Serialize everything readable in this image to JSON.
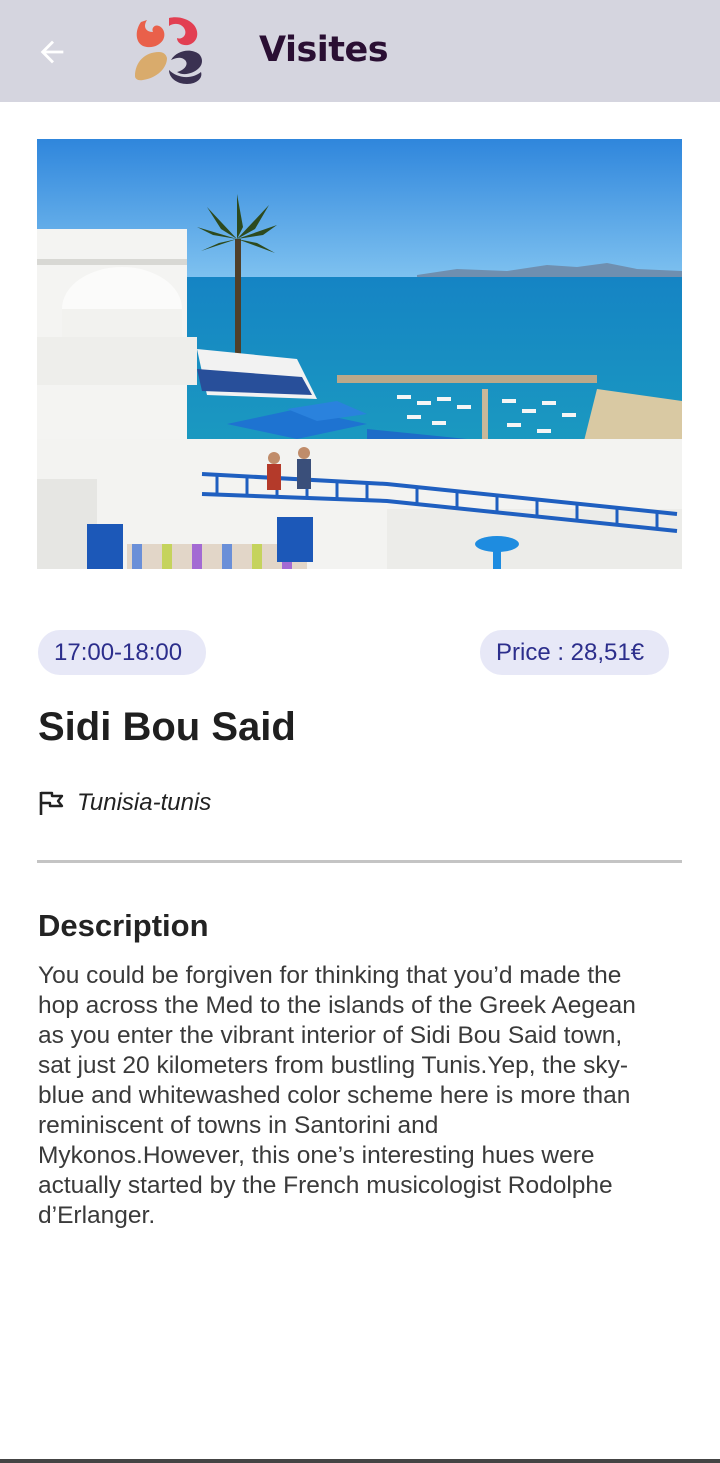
{
  "appbar": {
    "title": "Visites",
    "back_icon": "arrow-left-icon",
    "logo": "app-logo",
    "background": "#d5d5df",
    "title_color": "#2a0f33"
  },
  "hero": {
    "image": "sidi-bou-said-photo"
  },
  "visit": {
    "time": "17:00-18:00",
    "price": "Price : 28,51€",
    "title": "Sidi Bou Said",
    "location": "Tunisia-tunis",
    "location_icon": "flag-icon",
    "chip_color": "#e7e8f7",
    "chip_text_color": "#2c2e8c"
  },
  "description": {
    "heading": "Description",
    "lines": [
      "You could be forgiven for thinking that you’d made the",
      "hop across the Med to the islands of the Greek Aegean",
      "as you enter the vibrant interior of Sidi Bou Said town,",
      "sat just 20 kilometers from bustling Tunis.Yep, the sky-",
      "blue and whitewashed color scheme here is more than",
      "reminiscent of towns in Santorini and",
      "Mykonos.However, this one’s interesting hues were",
      "actually started by the French musicologist Rodolphe",
      "d’Erlanger."
    ]
  }
}
